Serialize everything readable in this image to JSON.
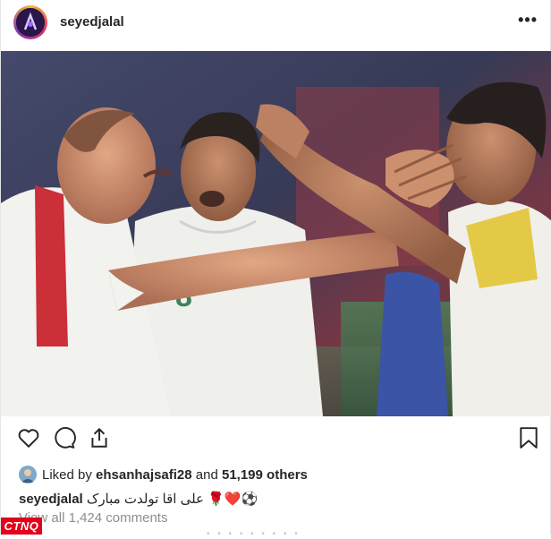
{
  "post": {
    "username": "seyedjalal",
    "more_label": "•••",
    "image_icon": "photo-of-three-footballers-celebrating"
  },
  "likes": {
    "prefix": "Liked by",
    "user": "ehsanhajsafi28",
    "middle": "and",
    "others": "51,199 others"
  },
  "caption": {
    "username": "seyedjalal",
    "text": "علی اقا تولدت مبارک 🌹❤️⚽"
  },
  "comments": {
    "label": "View all 1,424 comments"
  },
  "watermark": {
    "logo": "CTNQ",
    "faint_text": "• • • • • • • • •"
  },
  "colors": {
    "logo_red": "#e2001a",
    "muted_text": "#8e8e8e"
  },
  "icons": [
    "heart-icon",
    "comment-icon",
    "share-icon",
    "bookmark-icon"
  ]
}
